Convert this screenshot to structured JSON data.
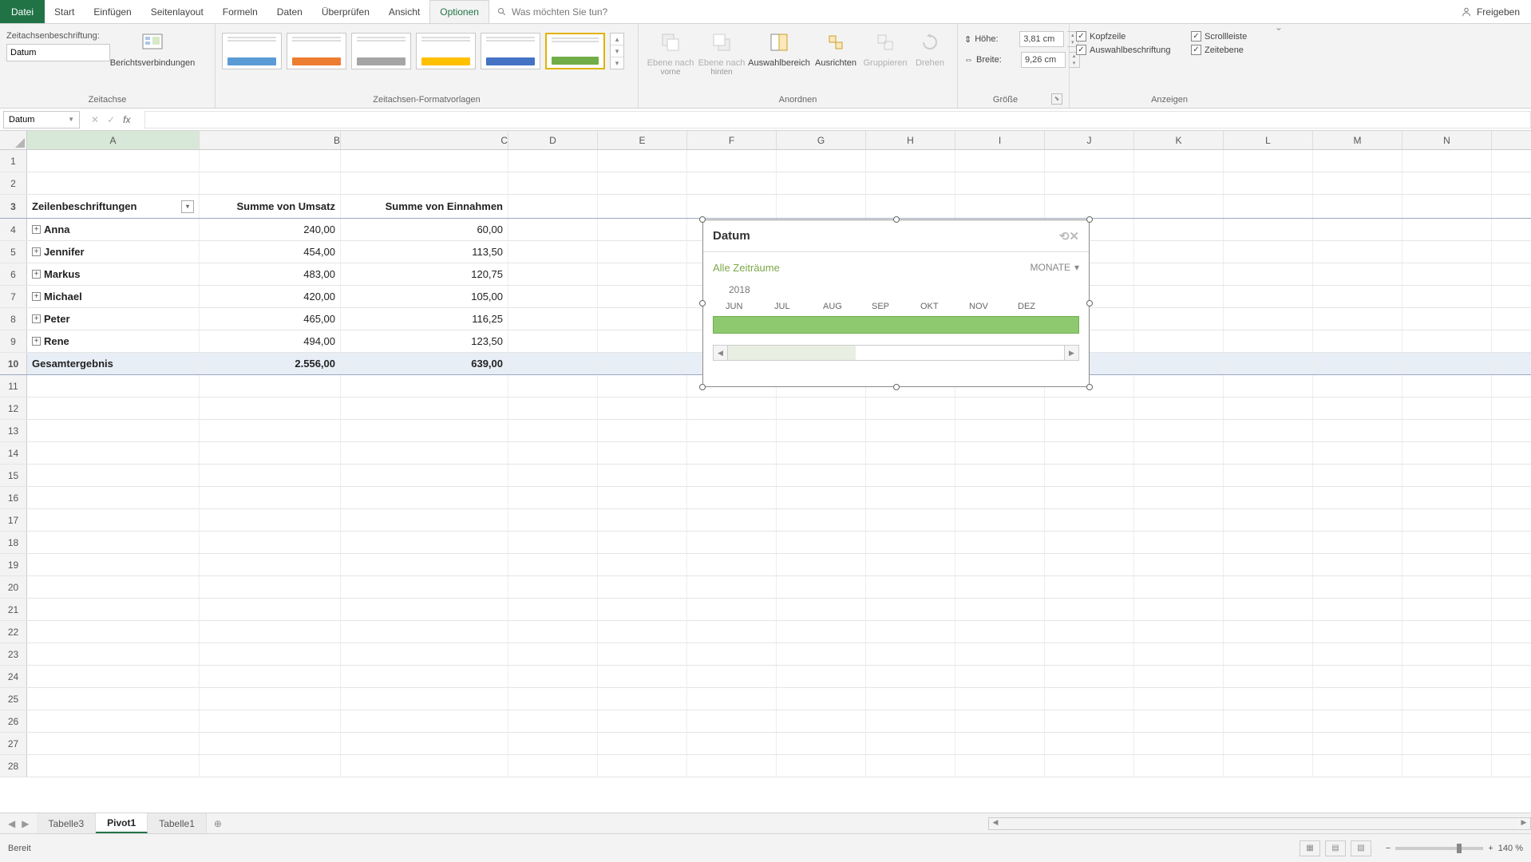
{
  "menu": {
    "file": "Datei",
    "tabs": [
      "Start",
      "Einfügen",
      "Seitenlayout",
      "Formeln",
      "Daten",
      "Überprüfen",
      "Ansicht",
      "Optionen"
    ],
    "active": "Optionen",
    "tellme": "Was möchten Sie tun?",
    "share": "Freigeben"
  },
  "ribbon": {
    "zeitachse": {
      "caption_label": "Zeitachsenbeschriftung:",
      "caption_value": "Datum",
      "connections": "Berichtsverbindungen",
      "group": "Zeitachse"
    },
    "styles": {
      "group": "Zeitachsen-Formatvorlagen"
    },
    "arrange": {
      "bring_forward": "Ebene nach",
      "bf_sub": "vorne",
      "send_backward": "Ebene nach",
      "sb_sub": "hinten",
      "selection": "Auswahlbereich",
      "align": "Ausrichten",
      "group_btn": "Gruppieren",
      "rotate": "Drehen",
      "group": "Anordnen"
    },
    "size": {
      "height_l": "Höhe:",
      "height_v": "3,81 cm",
      "width_l": "Breite:",
      "width_v": "9,26 cm",
      "group": "Größe"
    },
    "show": {
      "header": "Kopfzeile",
      "scrollbar": "Scrollleiste",
      "selection_label": "Auswahlbeschriftung",
      "time_level": "Zeitebene",
      "group": "Anzeigen"
    }
  },
  "namebox": "Datum",
  "columns": [
    "A",
    "B",
    "C",
    "D",
    "E",
    "F",
    "G",
    "H",
    "I",
    "J",
    "K",
    "L",
    "M",
    "N"
  ],
  "pivot": {
    "headers": {
      "rows": "Zeilenbeschriftungen",
      "c1": "Summe von Umsatz",
      "c2": "Summe von Einnahmen"
    },
    "data": [
      {
        "name": "Anna",
        "v1": "240,00",
        "v2": "60,00"
      },
      {
        "name": "Jennifer",
        "v1": "454,00",
        "v2": "113,50"
      },
      {
        "name": "Markus",
        "v1": "483,00",
        "v2": "120,75"
      },
      {
        "name": "Michael",
        "v1": "420,00",
        "v2": "105,00"
      },
      {
        "name": "Peter",
        "v1": "465,00",
        "v2": "116,25"
      },
      {
        "name": "Rene",
        "v1": "494,00",
        "v2": "123,50"
      }
    ],
    "total": {
      "label": "Gesamtergebnis",
      "v1": "2.556,00",
      "v2": "639,00"
    }
  },
  "slicer": {
    "title": "Datum",
    "period": "Alle Zeiträume",
    "level": "MONATE",
    "year": "2018",
    "months": [
      "JUN",
      "JUL",
      "AUG",
      "SEP",
      "OKT",
      "NOV",
      "DEZ"
    ]
  },
  "sheets": {
    "tabs": [
      "Tabelle3",
      "Pivot1",
      "Tabelle1"
    ],
    "active": "Pivot1"
  },
  "status": {
    "ready": "Bereit",
    "zoom": "140 %"
  }
}
